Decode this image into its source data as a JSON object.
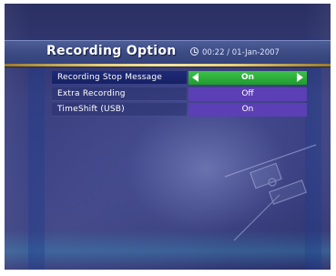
{
  "header": {
    "title": "Recording Option",
    "clock": "00:22 / 01-Jan-2007"
  },
  "menu": {
    "items": [
      {
        "label": "Recording Stop Message",
        "value": "On",
        "selected": true
      },
      {
        "label": "Extra Recording",
        "value": "Off",
        "selected": false
      },
      {
        "label": "TimeShift (USB)",
        "value": "On",
        "selected": false
      }
    ]
  },
  "colors": {
    "selected_value_bg": "#2fae3c",
    "value_bg": "#5b3fb4",
    "selected_label_bg": "#1b2670",
    "header_rule": "#e8d07a"
  },
  "icons": {
    "clock": "clock-icon",
    "left": "arrow-left-icon",
    "right": "arrow-right-icon"
  }
}
